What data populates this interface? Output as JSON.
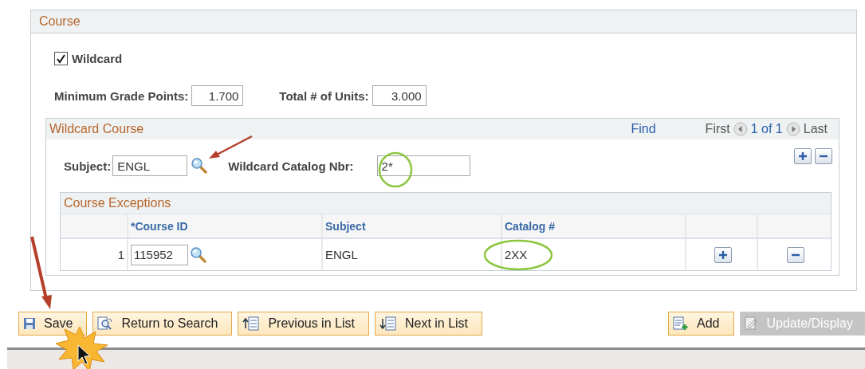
{
  "course_panel": {
    "title": "Course",
    "wildcard": {
      "label": "Wildcard",
      "checked": true
    },
    "fields": [
      {
        "label": "Minimum Grade Points:",
        "value": "1.700"
      },
      {
        "label": "Total # of Units:",
        "value": "3.000"
      }
    ],
    "wildcard_course": {
      "title": "Wildcard Course",
      "find": "Find",
      "first": "First",
      "count": "1 of 1",
      "last": "Last",
      "subject": {
        "label": "Subject:",
        "value": "ENGL"
      },
      "catalog": {
        "label": "Wildcard Catalog Nbr:",
        "value": "2*"
      },
      "exceptions": {
        "title": "Course Exceptions",
        "columns": [
          "*Course ID",
          "Subject",
          "Catalog #"
        ],
        "rows": [
          {
            "number": "1",
            "course_id": "115952",
            "subject": "ENGL",
            "catalog": "2XX"
          }
        ]
      }
    }
  },
  "buttons": [
    {
      "label": "Save",
      "kind": "save",
      "disabled": false
    },
    {
      "label": "Return to Search",
      "kind": "search",
      "disabled": false
    },
    {
      "label": "Previous in List",
      "kind": "previous",
      "disabled": false
    },
    {
      "label": "Next in List",
      "kind": "next",
      "disabled": false
    },
    {
      "label": "Add",
      "kind": "add",
      "disabled": false
    },
    {
      "label": "Update/Display",
      "kind": "update",
      "disabled": true
    }
  ]
}
